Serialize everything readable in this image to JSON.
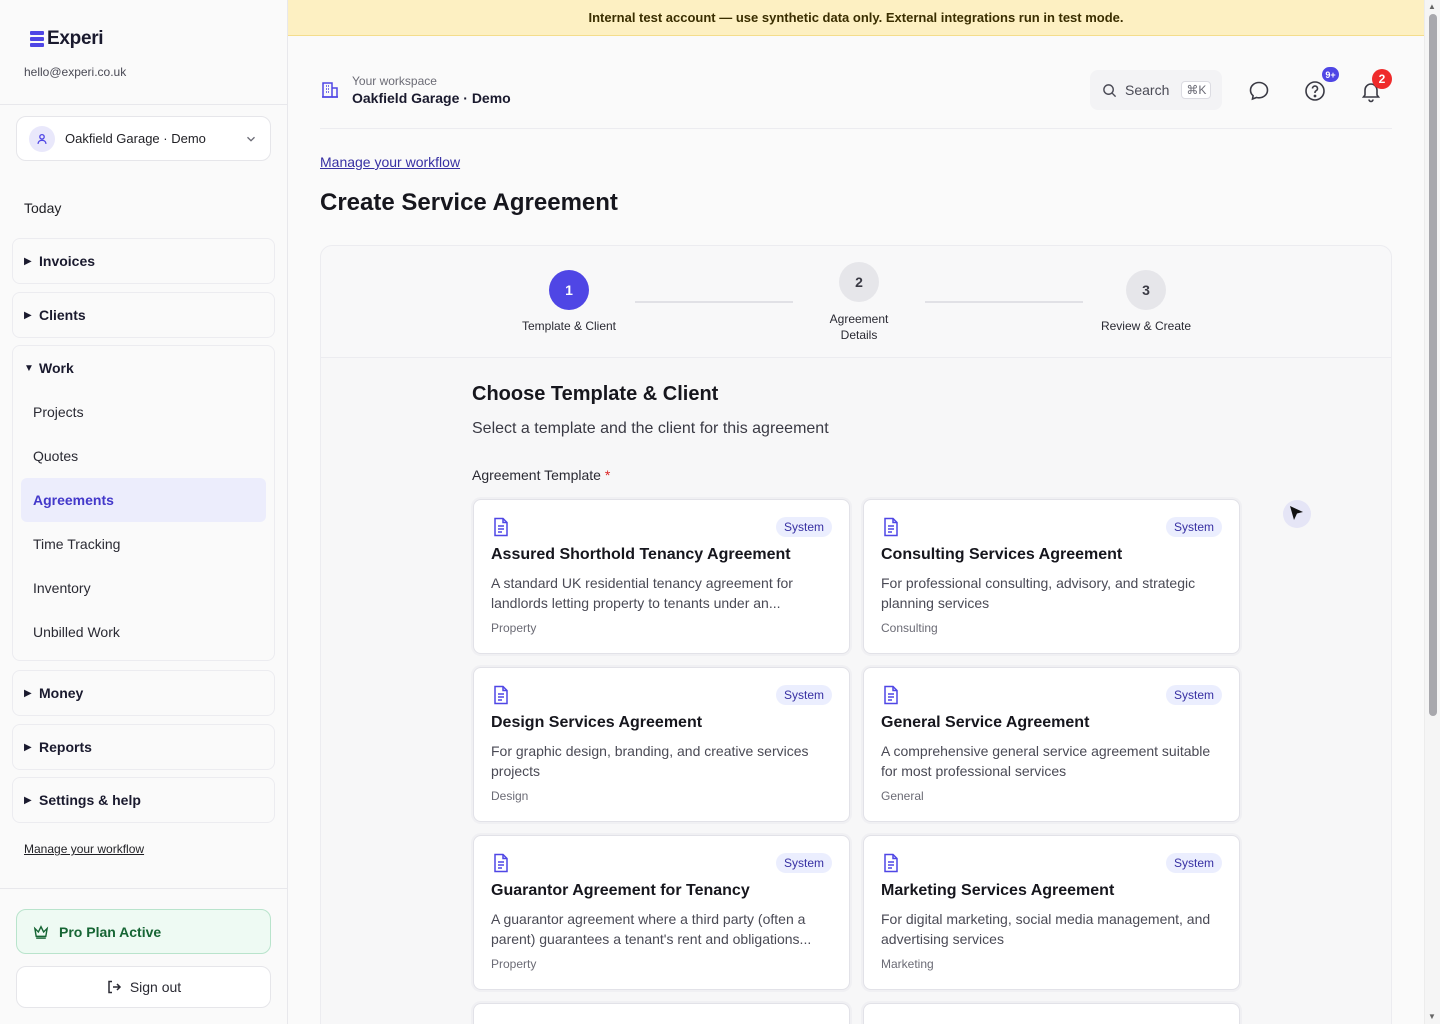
{
  "sidebar": {
    "brand": "Experi",
    "email": "hello@experi.co.uk",
    "org_name": "Oakfield Garage · Demo",
    "today": "Today",
    "groups": {
      "invoices": "Invoices",
      "clients": "Clients",
      "work": "Work",
      "money": "Money",
      "reports": "Reports",
      "settings": "Settings & help"
    },
    "work_items": [
      "Projects",
      "Quotes",
      "Agreements",
      "Time Tracking",
      "Inventory",
      "Unbilled Work"
    ],
    "active_item": "Agreements",
    "workflow_link": "Manage your workflow",
    "pro_label": "Pro Plan Active",
    "signout_label": "Sign out"
  },
  "banner": "Internal test account — use synthetic data only. External integrations run in test mode.",
  "header": {
    "workspace_caption": "Your workspace",
    "workspace_name": "Oakfield Garage · Demo",
    "search_label": "Search",
    "search_shortcut": "⌘K",
    "help_badge": "9+",
    "notifications_badge": "2"
  },
  "main": {
    "workflow_link": "Manage your workflow",
    "title": "Create Service Agreement",
    "steps": [
      {
        "number": "1",
        "label": "Template & Client",
        "active": true
      },
      {
        "number": "2",
        "label": "Agreement\nDetails",
        "active": false
      },
      {
        "number": "3",
        "label": "Review & Create",
        "active": false
      }
    ],
    "section_title": "Choose Template & Client",
    "section_subtitle": "Select a template and the client for this agreement",
    "template_label": "Agreement Template",
    "required_mark": "*",
    "templates": [
      {
        "badge": "System",
        "name": "Assured Shorthold Tenancy Agreement",
        "description": "A standard UK residential tenancy agreement for landlords letting property to tenants under an...",
        "category": "Property"
      },
      {
        "badge": "System",
        "name": "Consulting Services Agreement",
        "description": "For professional consulting, advisory, and strategic planning services",
        "category": "Consulting"
      },
      {
        "badge": "System",
        "name": "Design Services Agreement",
        "description": "For graphic design, branding, and creative services projects",
        "category": "Design"
      },
      {
        "badge": "System",
        "name": "General Service Agreement",
        "description": "A comprehensive general service agreement suitable for most professional services",
        "category": "General"
      },
      {
        "badge": "System",
        "name": "Guarantor Agreement for Tenancy",
        "description": "A guarantor agreement where a third party (often a parent) guarantees a tenant's rent and obligations...",
        "category": "Property"
      },
      {
        "badge": "System",
        "name": "Marketing Services Agreement",
        "description": "For digital marketing, social media management, and advertising services",
        "category": "Marketing"
      }
    ]
  },
  "colors": {
    "accent": "#4f46e5",
    "banner_bg": "#fdf0c2",
    "badge_red": "#ef2b2b",
    "pro_green": "#166534"
  }
}
